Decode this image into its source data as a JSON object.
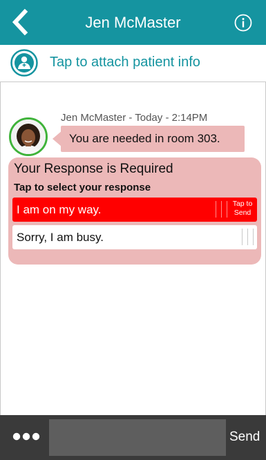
{
  "header": {
    "title": "Jen McMaster",
    "back_icon": "chevron-left-icon",
    "info_icon": "info-icon",
    "color": "#1594a0"
  },
  "attach": {
    "label": "Tap to attach patient info",
    "icon": "patient-icon"
  },
  "message": {
    "meta": "Jen McMaster - Today - 2:14PM",
    "text": "You are needed in room 303.",
    "bubble_color": "#ecb8b8",
    "avatar_border_color": "#3fb33a"
  },
  "response": {
    "title": "Your Response is Required",
    "subtitle": "Tap to select your response",
    "options": [
      {
        "label": "I am on my way.",
        "selected": true,
        "send_hint": "Tap to Send"
      },
      {
        "label": "Sorry, I am busy.",
        "selected": false
      }
    ],
    "selected_color": "#ff0000"
  },
  "composer": {
    "more_icon": "more-dots-icon",
    "input_value": "",
    "send_label": "Send"
  }
}
